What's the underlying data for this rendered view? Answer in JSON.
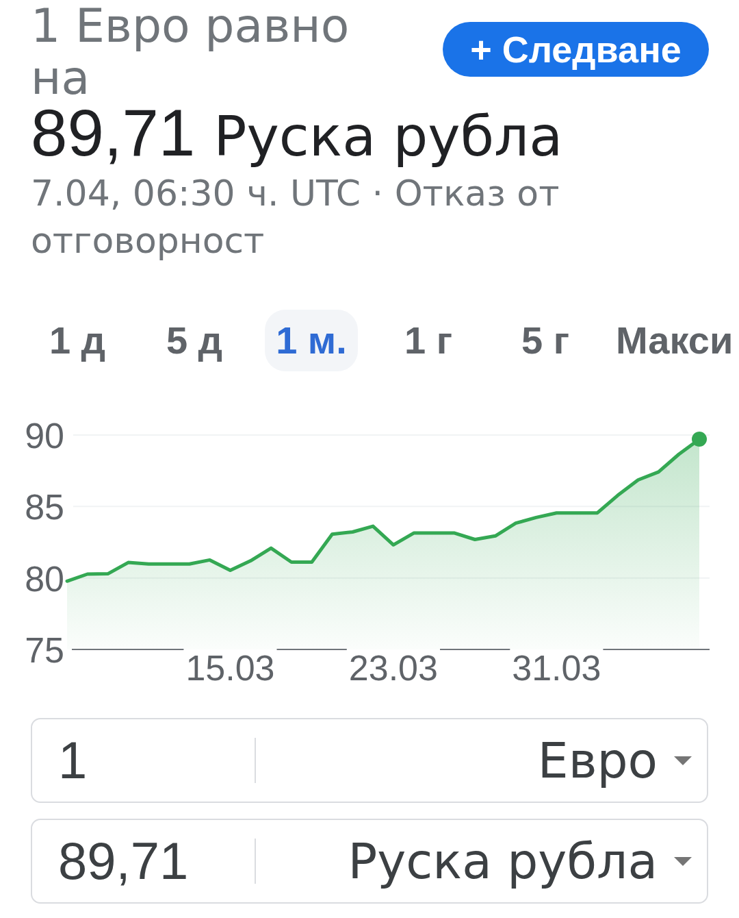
{
  "header": {
    "title": "1 Евро равно на",
    "follow_button": {
      "label": "+ Следване"
    },
    "amount": "89,71",
    "currency": "Руска рубла",
    "timestamp": "7.04, 06:30 ч. UTC · Отказ от отговорност"
  },
  "range_tabs": [
    {
      "label": "1 д",
      "selected": false
    },
    {
      "label": "5 д",
      "selected": false
    },
    {
      "label": "1 м.",
      "selected": true
    },
    {
      "label": "1 г",
      "selected": false
    },
    {
      "label": "5 г",
      "selected": false
    },
    {
      "label": "Макси",
      "selected": false
    }
  ],
  "chart": {
    "chart_data": {
      "type": "area",
      "categories": [
        null,
        null,
        null,
        null,
        null,
        null,
        null,
        null,
        "15.03",
        null,
        null,
        null,
        null,
        null,
        null,
        null,
        "23.03",
        null,
        null,
        null,
        null,
        null,
        null,
        null,
        "31.03",
        null,
        null,
        null,
        null,
        null,
        null,
        null
      ],
      "series": [
        {
          "color": "#34a853",
          "values": [
            79.78,
            80.27,
            80.29,
            81.08,
            80.98,
            80.98,
            80.98,
            81.26,
            80.53,
            81.2,
            82.09,
            81.11,
            81.11,
            83.06,
            83.22,
            83.62,
            82.32,
            83.14,
            83.14,
            83.14,
            82.69,
            82.94,
            83.83,
            84.23,
            84.55,
            84.55,
            84.55,
            85.78,
            86.86,
            87.42,
            88.66,
            89.71
          ]
        }
      ],
      "ylim": [
        75,
        90
      ],
      "yticks": [
        75,
        80,
        85,
        90
      ]
    }
  },
  "converter": [
    {
      "amount": "1",
      "currency": "Евро"
    },
    {
      "amount": "89,71",
      "currency": "Руска рубла"
    }
  ]
}
